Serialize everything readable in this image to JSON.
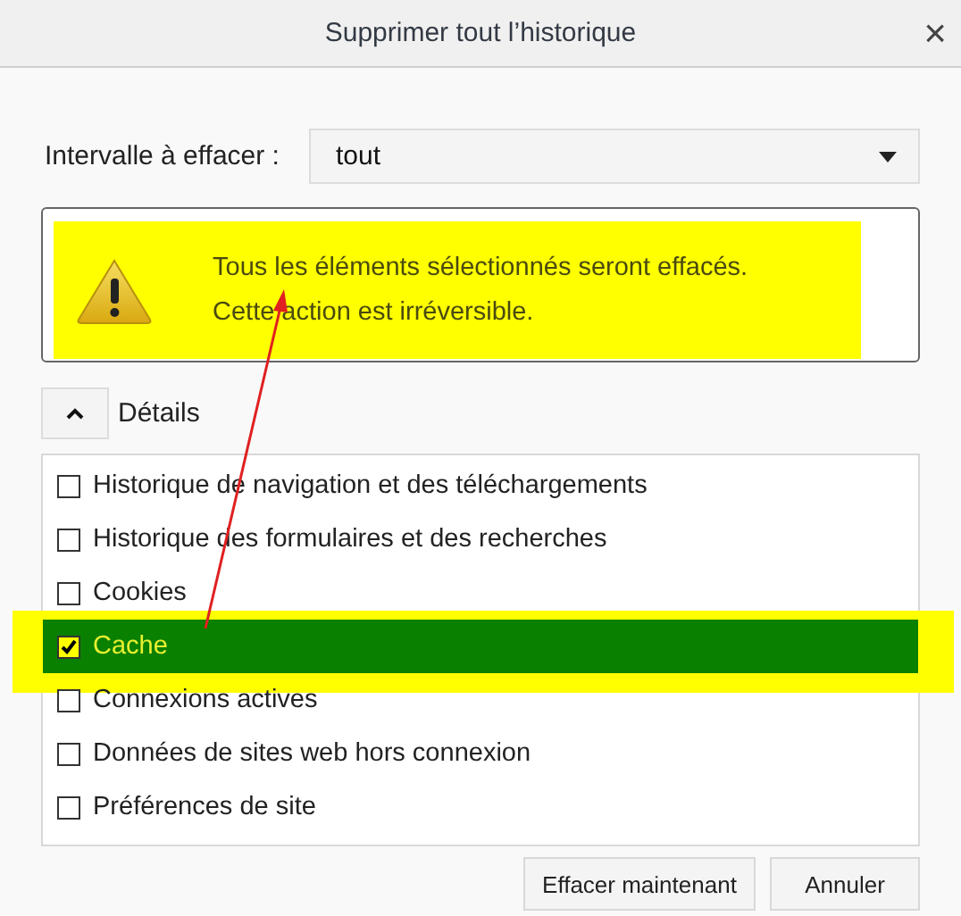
{
  "window": {
    "title": "Supprimer tout l’historique",
    "close": "×"
  },
  "range": {
    "label": "Intervalle à effacer :",
    "value": "tout"
  },
  "warning": {
    "highlighted": true,
    "lines": [
      "Tous les éléments sélectionnés seront effacés.",
      "Cette action est irréversible."
    ]
  },
  "details": {
    "label": "Détails",
    "expanded": true
  },
  "items": [
    {
      "label": "Historique de navigation et des téléchargements",
      "checked": false,
      "selected": false
    },
    {
      "label": "Historique des formulaires et des recherches",
      "checked": false,
      "selected": false
    },
    {
      "label": "Cookies",
      "checked": false,
      "selected": false
    },
    {
      "label": "Cache",
      "checked": true,
      "selected": true
    },
    {
      "label": "Connexions actives",
      "checked": false,
      "selected": false
    },
    {
      "label": "Données de sites web hors connexion",
      "checked": false,
      "selected": false
    },
    {
      "label": "Préférences de site",
      "checked": false,
      "selected": false
    }
  ],
  "buttons": [
    "Effacer maintenant",
    "Annuler"
  ]
}
